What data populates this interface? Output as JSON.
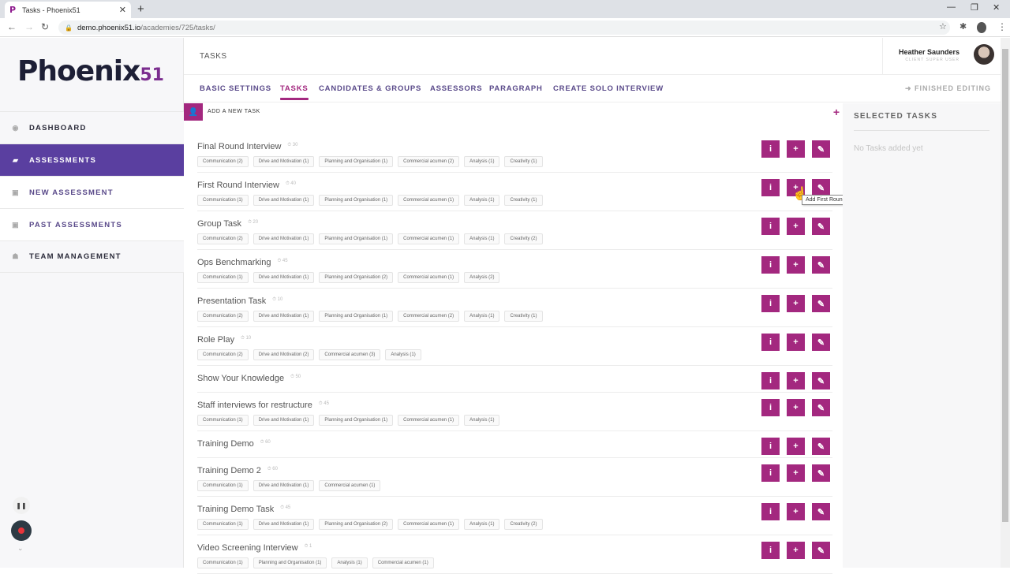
{
  "browser": {
    "tab_title": "Tasks - Phoenix51",
    "favicon": "P",
    "url_host": "demo.phoenix51.io",
    "url_path": "/academies/725/tasks/"
  },
  "logo": {
    "text": "Phoenix",
    "number": "51"
  },
  "sidebar": {
    "items": [
      {
        "label": "DASHBOARD",
        "icon": "dashboard-icon"
      },
      {
        "label": "ASSESSMENTS",
        "icon": "graduation-cap-icon"
      },
      {
        "label": "NEW ASSESSMENT",
        "icon": "calendar-plus-icon"
      },
      {
        "label": "PAST ASSESSMENTS",
        "icon": "calendar-minus-icon"
      },
      {
        "label": "TEAM MANAGEMENT",
        "icon": "team-icon"
      }
    ]
  },
  "header": {
    "page_title": "TASKS",
    "user_name": "Heather Saunders",
    "user_role": "CLIENT SUPER USER"
  },
  "tabs": [
    "BASIC SETTINGS",
    "TASKS",
    "CANDIDATES & GROUPS",
    "ASSESSORS",
    "PARAGRAPH",
    "CREATE SOLO INTERVIEW"
  ],
  "active_tab": "TASKS",
  "finished_editing": "FINISHED EDITING",
  "add_task_label": "ADD A NEW TASK",
  "tasks": [
    {
      "name": "Final Round Interview",
      "duration": "30",
      "competencies": [
        "Communication (2)",
        "Drive and Motivation (1)",
        "Planning and Organisation (1)",
        "Commercial acumen (2)",
        "Analysis (1)",
        "Creativity (1)"
      ]
    },
    {
      "name": "First Round Interview",
      "duration": "40",
      "competencies": [
        "Communication (1)",
        "Drive and Motivation (1)",
        "Planning and Organisation (1)",
        "Commercial acumen (1)",
        "Analysis (1)",
        "Creativity (1)"
      ]
    },
    {
      "name": "Group Task",
      "duration": "20",
      "competencies": [
        "Communication (2)",
        "Drive and Motivation (1)",
        "Planning and Organisation (1)",
        "Commercial acumen (1)",
        "Analysis (1)",
        "Creativity (2)"
      ]
    },
    {
      "name": "Ops Benchmarking",
      "duration": "45",
      "competencies": [
        "Communication (1)",
        "Drive and Motivation (1)",
        "Planning and Organisation (2)",
        "Commercial acumen (1)",
        "Analysis (2)"
      ]
    },
    {
      "name": "Presentation Task",
      "duration": "10",
      "competencies": [
        "Communication (2)",
        "Drive and Motivation (1)",
        "Planning and Organisation (1)",
        "Commercial acumen (2)",
        "Analysis (1)",
        "Creativity (1)"
      ]
    },
    {
      "name": "Role Play",
      "duration": "10",
      "competencies": [
        "Communication (2)",
        "Drive and Motivation (2)",
        "Commercial acumen (3)",
        "Analysis (1)"
      ]
    },
    {
      "name": "Show Your Knowledge",
      "duration": "50",
      "competencies": []
    },
    {
      "name": "Staff interviews for restructure",
      "duration": "45",
      "competencies": [
        "Communication (1)",
        "Drive and Motivation (1)",
        "Planning and Organisation (1)",
        "Commercial acumen (1)",
        "Analysis (1)"
      ]
    },
    {
      "name": "Training Demo",
      "duration": "60",
      "competencies": []
    },
    {
      "name": "Training Demo 2",
      "duration": "60",
      "competencies": [
        "Communication (1)",
        "Drive and Motivation (1)",
        "Commercial acumen (1)"
      ]
    },
    {
      "name": "Training Demo Task",
      "duration": "45",
      "competencies": [
        "Communication (1)",
        "Drive and Motivation (1)",
        "Planning and Organisation (2)",
        "Commercial acumen (1)",
        "Analysis (1)",
        "Creativity (2)"
      ]
    },
    {
      "name": "Video Screening Interview",
      "duration": "1",
      "competencies": [
        "Communication (1)",
        "Planning and Organisation (1)",
        "Analysis (1)",
        "Commercial acumen (1)"
      ]
    }
  ],
  "tooltip": "Add First Round Interview",
  "selected_panel": {
    "title": "SELECTED TASKS",
    "empty": "No Tasks added yet"
  },
  "colors": {
    "accent": "#a3287f",
    "sidebar_active": "#5a3fa0",
    "nav_text": "#5a4a8a"
  }
}
